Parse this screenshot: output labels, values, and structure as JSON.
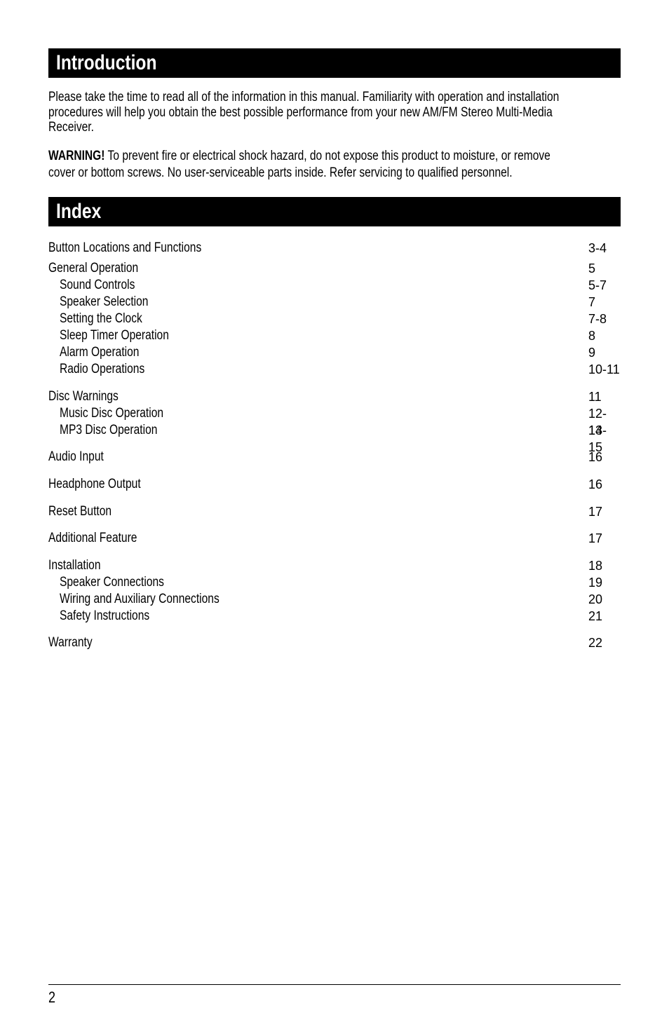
{
  "introduction": {
    "heading": "Introduction",
    "paragraph_lines": [
      "Please take the time to read all of the information in this manual. Familiarity with operation and installation",
      "procedures will help you obtain the best possible performance from your new AM/FM Stereo Multi-Media",
      "Receiver."
    ],
    "warning_label": "WARNING!",
    "warning_lines": [
      " To prevent fire or electrical shock hazard, do not expose this product to moisture, or remove",
      "cover or bottom screws. No user-serviceable parts inside. Refer servicing to qualified personnel."
    ]
  },
  "index": {
    "heading": "Index",
    "entries": [
      {
        "label": "Button Locations and Functions",
        "page": "3-4",
        "level": 0
      },
      {
        "label": "General Operation",
        "page": "5",
        "level": 0
      },
      {
        "label": "Sound Controls",
        "page": "5-7",
        "level": 1
      },
      {
        "label": "Speaker Selection",
        "page": "7",
        "level": 1
      },
      {
        "label": "Setting the Clock",
        "page": "7-8",
        "level": 1
      },
      {
        "label": "Sleep Timer Operation",
        "page": "8",
        "level": 1
      },
      {
        "label": "Alarm Operation",
        "page": "9",
        "level": 1
      },
      {
        "label": "Radio Operations",
        "page": "10-11",
        "level": 1
      },
      {
        "label": "Disc Warnings",
        "page": "11",
        "level": 0
      },
      {
        "label": "Music Disc Operation",
        "page": "12-13",
        "level": 1
      },
      {
        "label": "MP3 Disc Operation",
        "page": "14-15",
        "level": 1
      },
      {
        "label": "Audio Input",
        "page": "16",
        "level": 0
      },
      {
        "label": "Headphone Output",
        "page": "16",
        "level": 0
      },
      {
        "label": "Reset Button",
        "page": "17",
        "level": 0
      },
      {
        "label": "Additional Feature",
        "page": "17",
        "level": 0
      },
      {
        "label": "Installation",
        "page": "18",
        "level": 0
      },
      {
        "label": "Speaker Connections",
        "page": "19",
        "level": 1
      },
      {
        "label": "Wiring and Auxiliary Connections",
        "page": "20",
        "level": 1
      },
      {
        "label": "Safety Instructions",
        "page": "21",
        "level": 1
      },
      {
        "label": "Warranty",
        "page": "22",
        "level": 0
      }
    ]
  },
  "footer": {
    "page_number": "2"
  }
}
